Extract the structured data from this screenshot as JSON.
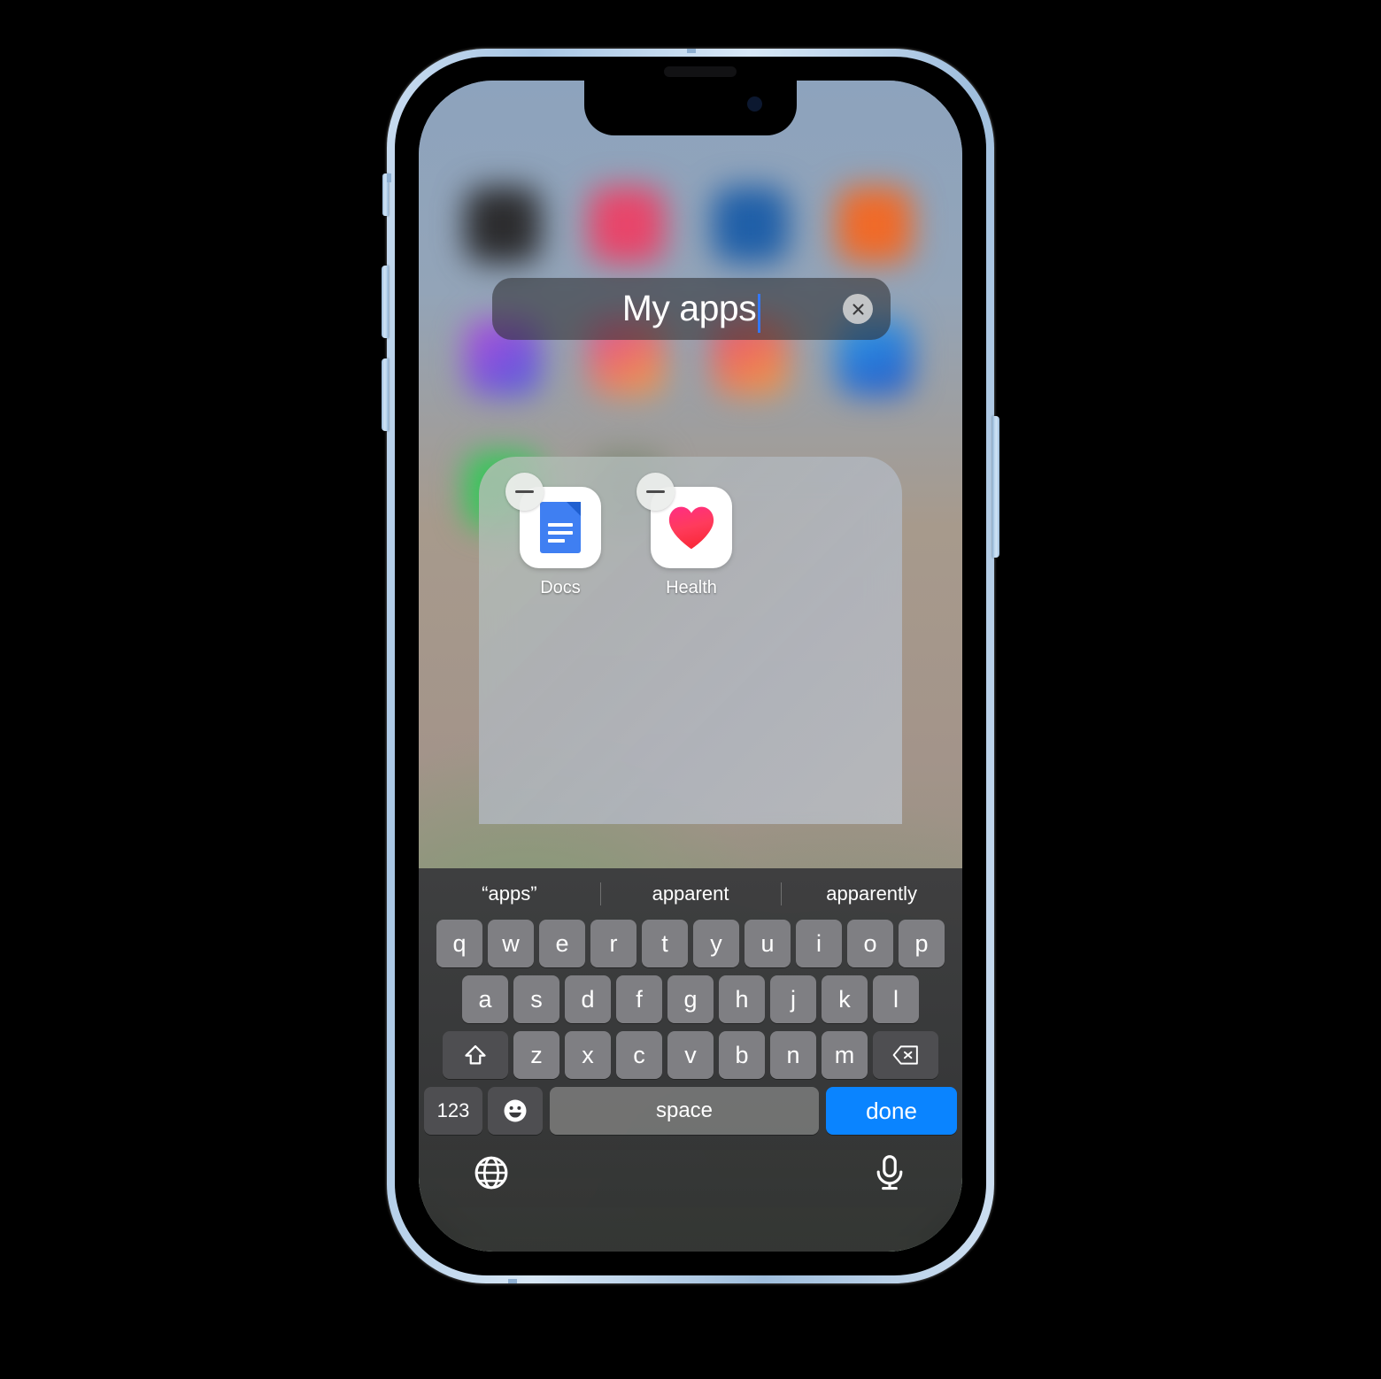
{
  "device": {
    "name": "iphone-13-blue",
    "frame_color": "#b8d2ea",
    "buttons": [
      "mute-switch",
      "volume-up",
      "volume-down",
      "power-button"
    ]
  },
  "folder_rename": {
    "field_value": "My apps",
    "clear_icon": "close-circle-icon",
    "caret_color": "#3478f6",
    "caret_visible": true
  },
  "folder": {
    "apps": [
      {
        "label": "Docs",
        "icon": "google-docs-icon",
        "badge": "remove-minus-badge"
      },
      {
        "label": "Health",
        "icon": "apple-health-heart-icon",
        "badge": "remove-minus-badge"
      }
    ]
  },
  "keyboard": {
    "predictions": [
      "“apps”",
      "apparent",
      "apparently"
    ],
    "row1": [
      "q",
      "w",
      "e",
      "r",
      "t",
      "y",
      "u",
      "i",
      "o",
      "p"
    ],
    "row2": [
      "a",
      "s",
      "d",
      "f",
      "g",
      "h",
      "j",
      "k",
      "l"
    ],
    "row3": [
      "z",
      "x",
      "c",
      "v",
      "b",
      "n",
      "m"
    ],
    "shift_icon": "shift-arrow-icon",
    "backspace_icon": "backspace-delete-icon",
    "numbers_label": "123",
    "emoji_icon": "emoji-smiley-icon",
    "space_label": "space",
    "done_label": "done",
    "done_color": "#0a84ff",
    "globe_icon": "globe-language-icon",
    "mic_icon": "microphone-dictation-icon"
  },
  "background_apps": {
    "row1": [
      "#2c2c2e",
      "#e8456a",
      "#1f5fa8",
      "#f06a28"
    ],
    "row2": [
      "#9b5de5",
      "#e0459a",
      "#f2a33c",
      "#2f7fe0"
    ]
  }
}
